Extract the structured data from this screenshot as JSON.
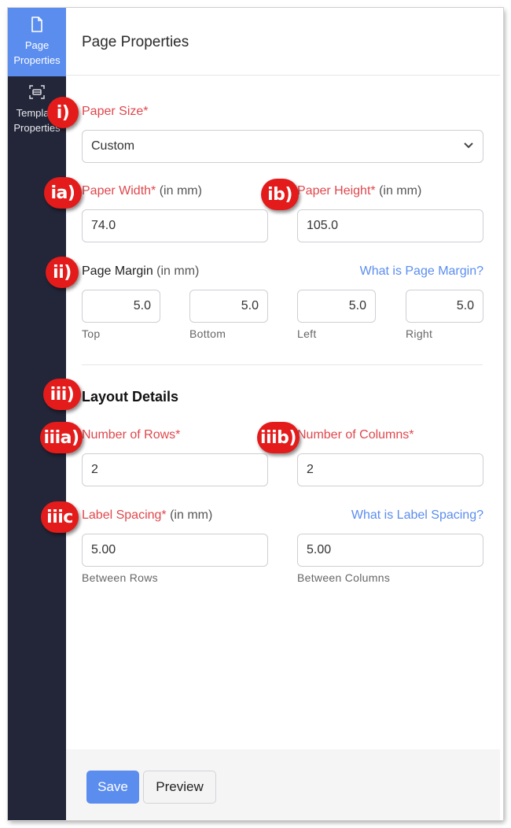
{
  "sidebar": {
    "items": [
      {
        "label_line1": "Page",
        "label_line2": "Properties",
        "icon": "document-icon",
        "active": true
      },
      {
        "label_line1": "Template",
        "label_line2": "Properties",
        "icon": "template-icon",
        "active": false
      }
    ]
  },
  "header": {
    "title": "Page Properties"
  },
  "paper_size": {
    "label": "Paper Size*",
    "value": "Custom",
    "badge": "i)"
  },
  "paper_width": {
    "label": "Paper Width*",
    "unit": "(in mm)",
    "value": "74.0",
    "badge": "ia)"
  },
  "paper_height": {
    "label": "Paper Height*",
    "unit": "(in mm)",
    "value": "105.0",
    "badge": "ib)"
  },
  "page_margin": {
    "label": "Page Margin",
    "unit": "(in mm)",
    "help_link": "What is Page Margin?",
    "badge": "ii)",
    "fields": [
      {
        "value": "5.0",
        "caption": "Top"
      },
      {
        "value": "5.0",
        "caption": "Bottom"
      },
      {
        "value": "5.0",
        "caption": "Left"
      },
      {
        "value": "5.0",
        "caption": "Right"
      }
    ]
  },
  "layout": {
    "title": "Layout Details",
    "badge": "iii)"
  },
  "rows": {
    "label": "Number of Rows*",
    "value": "2",
    "badge": "iiia)"
  },
  "columns": {
    "label": "Number of Columns*",
    "value": "2",
    "badge": "iiib)"
  },
  "label_spacing": {
    "label": "Label Spacing*",
    "unit": "(in mm)",
    "help_link": "What is Label Spacing?",
    "badge": "iiic",
    "between_rows": {
      "value": "5.00",
      "caption": "Between Rows"
    },
    "between_columns": {
      "value": "5.00",
      "caption": "Between Columns"
    }
  },
  "footer": {
    "save_label": "Save",
    "preview_label": "Preview"
  },
  "colors": {
    "accent": "#5b8def",
    "required_label": "#e0474c",
    "sidebar": "#232638",
    "badge": "#e31b1b"
  }
}
